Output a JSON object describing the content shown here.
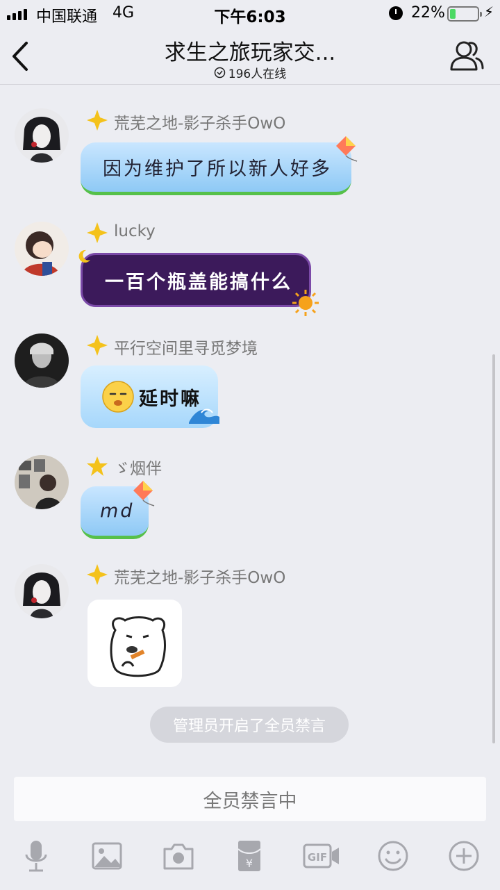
{
  "status_bar": {
    "carrier": "中国联通",
    "network": "4G",
    "time": "下午6:03",
    "battery_percent": "22%",
    "battery_level": 0.22,
    "icons": [
      "signal-icon",
      "alarm-icon",
      "battery-icon",
      "charging-icon"
    ]
  },
  "nav": {
    "title": "求生之旅玩家交...",
    "online_count": "196人在线",
    "icons": [
      "back-icon",
      "clock-icon",
      "members-icon"
    ]
  },
  "messages": [
    {
      "sender": "荒芜之地-影子杀手OwO",
      "text": "因为维护了所以新人好多",
      "bubble_style": "kite"
    },
    {
      "sender": "lucky",
      "text": "一百个瓶盖能搞什么",
      "bubble_style": "purple-night"
    },
    {
      "sender": "平行空间里寻觅梦境",
      "text": "延时嘛",
      "bubble_style": "wave"
    },
    {
      "sender": "ゞ烟伴",
      "text": "md",
      "bubble_style": "kite"
    },
    {
      "sender": "荒芜之地-影子杀手OwO",
      "text": "",
      "bubble_style": "sticker"
    }
  ],
  "system_notice": "管理员开启了全员禁言",
  "input_bar": {
    "status": "全员禁言中"
  },
  "toolbar": [
    "microphone-icon",
    "image-icon",
    "camera-icon",
    "red-packet-icon",
    "gif-icon",
    "emoji-icon",
    "plus-icon"
  ],
  "colors": {
    "background": "#ecedf2",
    "bubble_blue": "#a6d7fb",
    "bubble_purple": "#3c1a5b",
    "battery_green": "#4cd964"
  }
}
